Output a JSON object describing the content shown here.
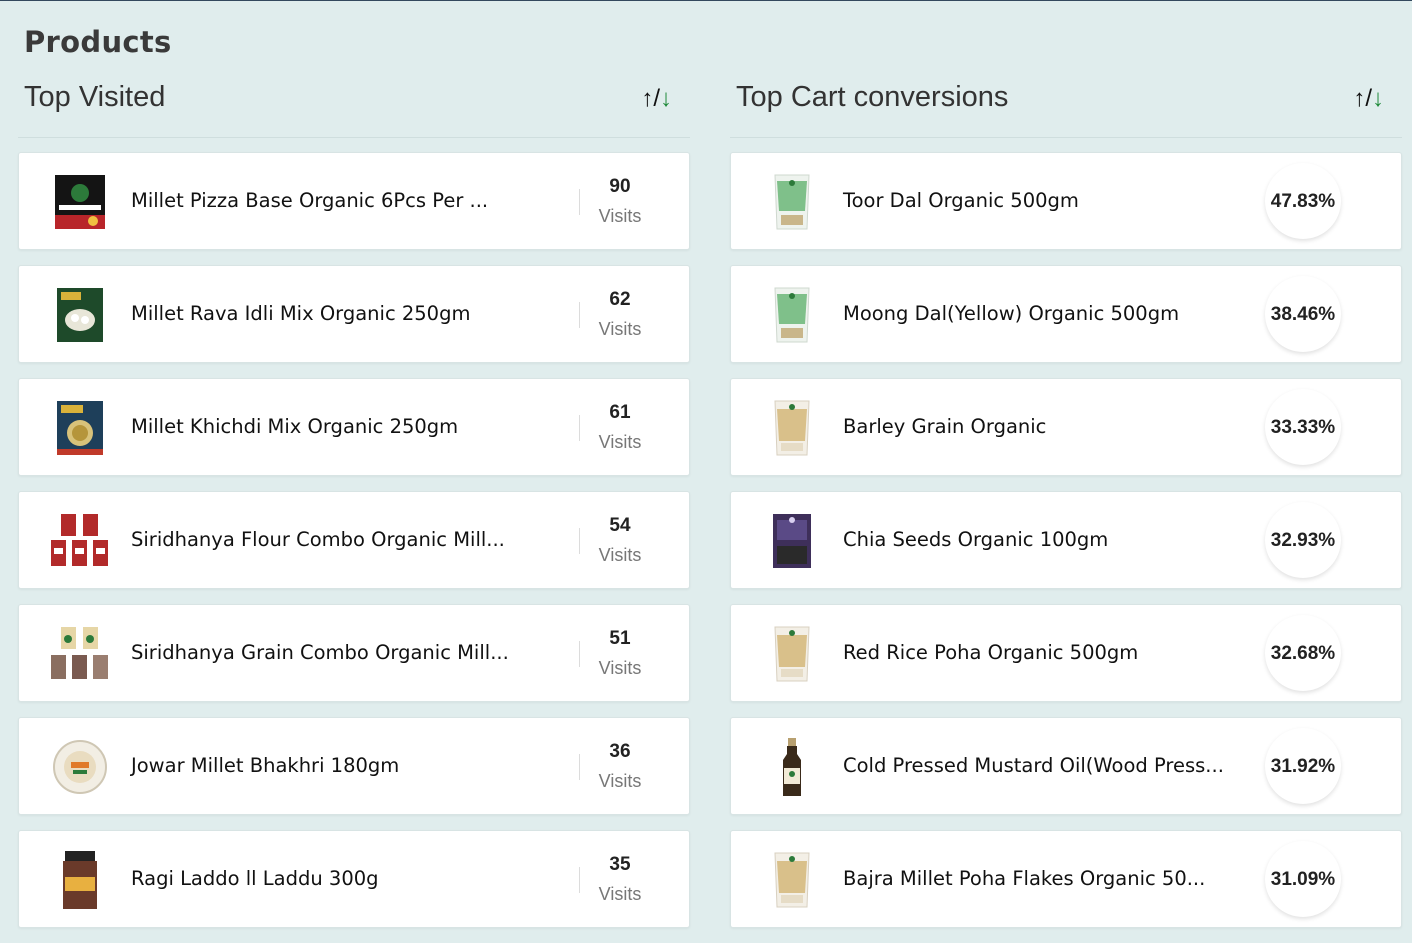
{
  "page": {
    "title": "Products"
  },
  "top_visited": {
    "title": "Top Visited",
    "sort": {
      "up": "↑",
      "sep": "/",
      "down": "↓"
    },
    "items": [
      {
        "name": "Millet Pizza Base Organic 6Pcs Per ...",
        "count": "90",
        "unit": "Visits",
        "thumb": "pizza-base-box"
      },
      {
        "name": "Millet Rava Idli Mix Organic 250gm",
        "count": "62",
        "unit": "Visits",
        "thumb": "idli-mix-box"
      },
      {
        "name": "Millet Khichdi Mix Organic 250gm",
        "count": "61",
        "unit": "Visits",
        "thumb": "khichdi-mix-box"
      },
      {
        "name": "Siridhanya Flour Combo Organic Mill...",
        "count": "54",
        "unit": "Visits",
        "thumb": "flour-combo-packs"
      },
      {
        "name": "Siridhanya Grain Combo Organic Mill...",
        "count": "51",
        "unit": "Visits",
        "thumb": "grain-combo-packs"
      },
      {
        "name": "Jowar Millet Bhakhri 180gm",
        "count": "36",
        "unit": "Visits",
        "thumb": "bhakhri-pack"
      },
      {
        "name": "Ragi Laddo ll Laddu 300g",
        "count": "35",
        "unit": "Visits",
        "thumb": "laddu-jar"
      }
    ]
  },
  "top_cart": {
    "title": "Top Cart conversions",
    "sort": {
      "up": "↑",
      "sep": "/",
      "down": "↓"
    },
    "items": [
      {
        "name": "Toor Dal Organic 500gm",
        "value": "47.83%",
        "thumb": "green-pouch"
      },
      {
        "name": "Moong Dal(Yellow) Organic 500gm",
        "value": "38.46%",
        "thumb": "green-pouch"
      },
      {
        "name": "Barley Grain Organic",
        "value": "33.33%",
        "thumb": "tan-pouch"
      },
      {
        "name": "Chia Seeds Organic 100gm",
        "value": "32.93%",
        "thumb": "purple-pouch"
      },
      {
        "name": "Red Rice Poha Organic 500gm",
        "value": "32.68%",
        "thumb": "tan-pouch"
      },
      {
        "name": "Cold Pressed Mustard Oil(Wood Press...",
        "value": "31.92%",
        "thumb": "oil-bottle"
      },
      {
        "name": "Bajra Millet Poha Flakes Organic 50...",
        "value": "31.09%",
        "thumb": "tan-pouch"
      }
    ]
  }
}
